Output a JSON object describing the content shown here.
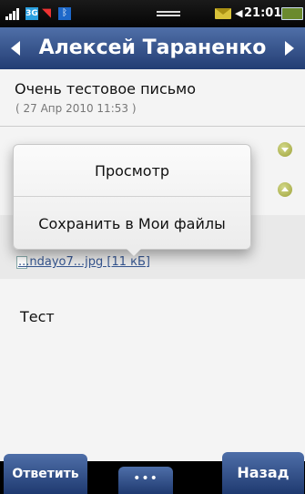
{
  "status_bar": {
    "network_badge": "3G",
    "time": "21:01",
    "icons": [
      "signal-icon",
      "3g-icon",
      "external-memory-icon",
      "bluetooth-icon",
      "mail-icon",
      "speaker-icon",
      "battery-icon"
    ]
  },
  "header": {
    "title": "Алексей Тараненко",
    "prev_icon": "triangle-left-icon",
    "next_icon": "triangle-right-icon"
  },
  "message": {
    "subject": "Очень тестовое письмо",
    "date": "( 27 Апр 2010 11:53 )",
    "body": "Тест",
    "attachment_partial": "...ndayo7...jpg [11 кБ]"
  },
  "popup": {
    "items": [
      "Просмотр",
      "Сохранить в Мои файлы"
    ]
  },
  "bottom_bar": {
    "reply": "Ответить",
    "more": "•••",
    "back": "Назад"
  },
  "colors": {
    "header": "#2f4f8a",
    "content_bg": "#f4f4f4",
    "toggle": "#b7bd55"
  }
}
